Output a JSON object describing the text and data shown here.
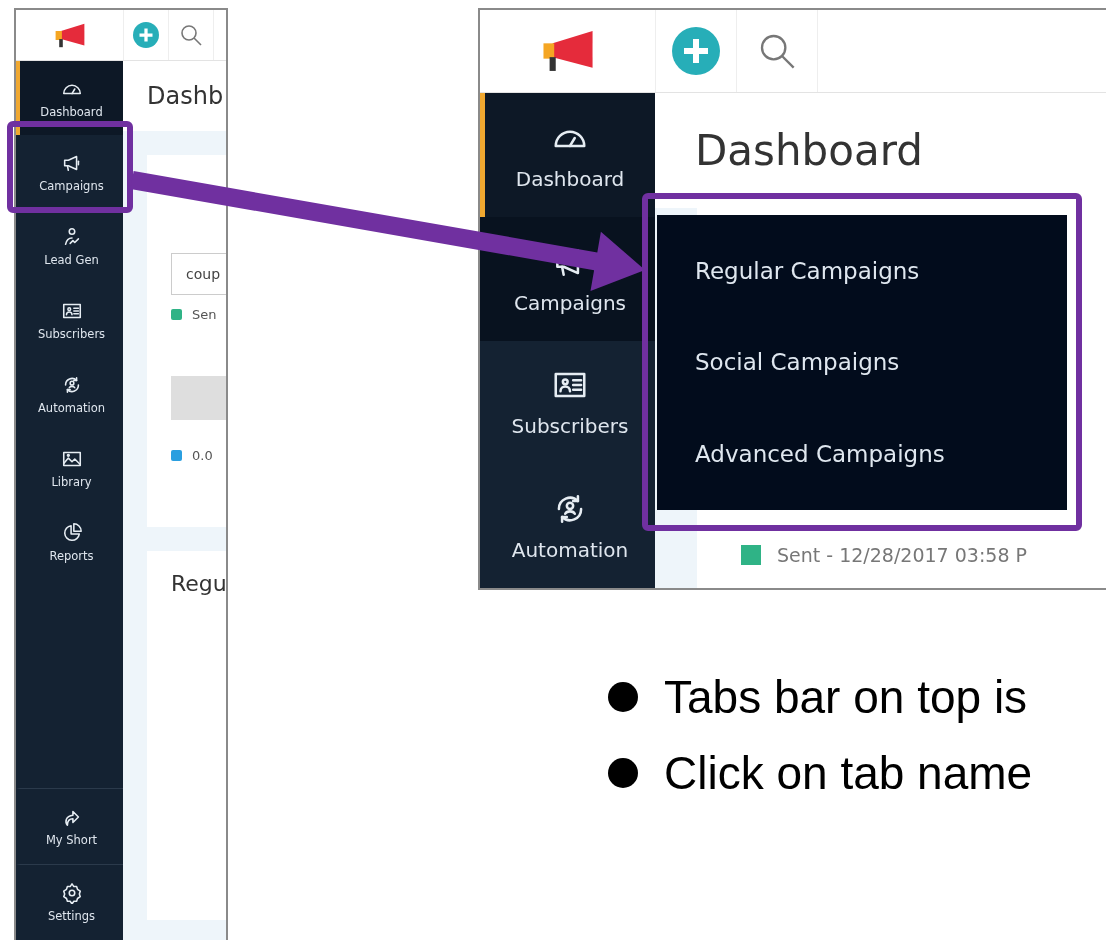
{
  "left_screenshot": {
    "page_title": "Dashb",
    "nav_items": [
      {
        "label": "Dashboard",
        "kind": "dashboard",
        "selected": true
      },
      {
        "label": "Campaigns",
        "kind": "campaigns",
        "selected": false
      },
      {
        "label": "Lead Gen",
        "kind": "leadgen",
        "selected": false
      },
      {
        "label": "Subscribers",
        "kind": "subscribers",
        "selected": false
      },
      {
        "label": "Automation",
        "kind": "automation",
        "selected": false
      },
      {
        "label": "Library",
        "kind": "library",
        "selected": false
      },
      {
        "label": "Reports",
        "kind": "reports",
        "selected": false
      }
    ],
    "nav_bottom": [
      {
        "label": "My Short",
        "kind": "myshort",
        "selected": false
      },
      {
        "label": "Settings",
        "kind": "settings",
        "selected": false
      }
    ],
    "search_value": "coup",
    "legend": [
      {
        "label": "Sen",
        "color": "#2fb386"
      },
      {
        "label": "0.0",
        "color": "#2a9fe0"
      }
    ],
    "section_title": "Regu"
  },
  "right_screenshot": {
    "page_title": "Dashboard",
    "nav_items": [
      {
        "label": "Dashboard",
        "kind": "dashboard",
        "selected": true,
        "expanded": false
      },
      {
        "label": "Campaigns",
        "kind": "campaigns",
        "selected": false,
        "expanded": true
      },
      {
        "label": "Subscribers",
        "kind": "subscribers",
        "selected": false,
        "expanded": false
      },
      {
        "label": "Automation",
        "kind": "automation",
        "selected": false,
        "expanded": false
      }
    ],
    "menu_items": [
      "Regular Campaigns",
      "Social Campaigns",
      "Advanced Campaigns"
    ],
    "legend": {
      "label": "Sent - 12/28/2017 03:58 P",
      "color": "#2fb386"
    }
  },
  "bullets": [
    "Tabs bar on top is",
    "Click on tab name"
  ]
}
